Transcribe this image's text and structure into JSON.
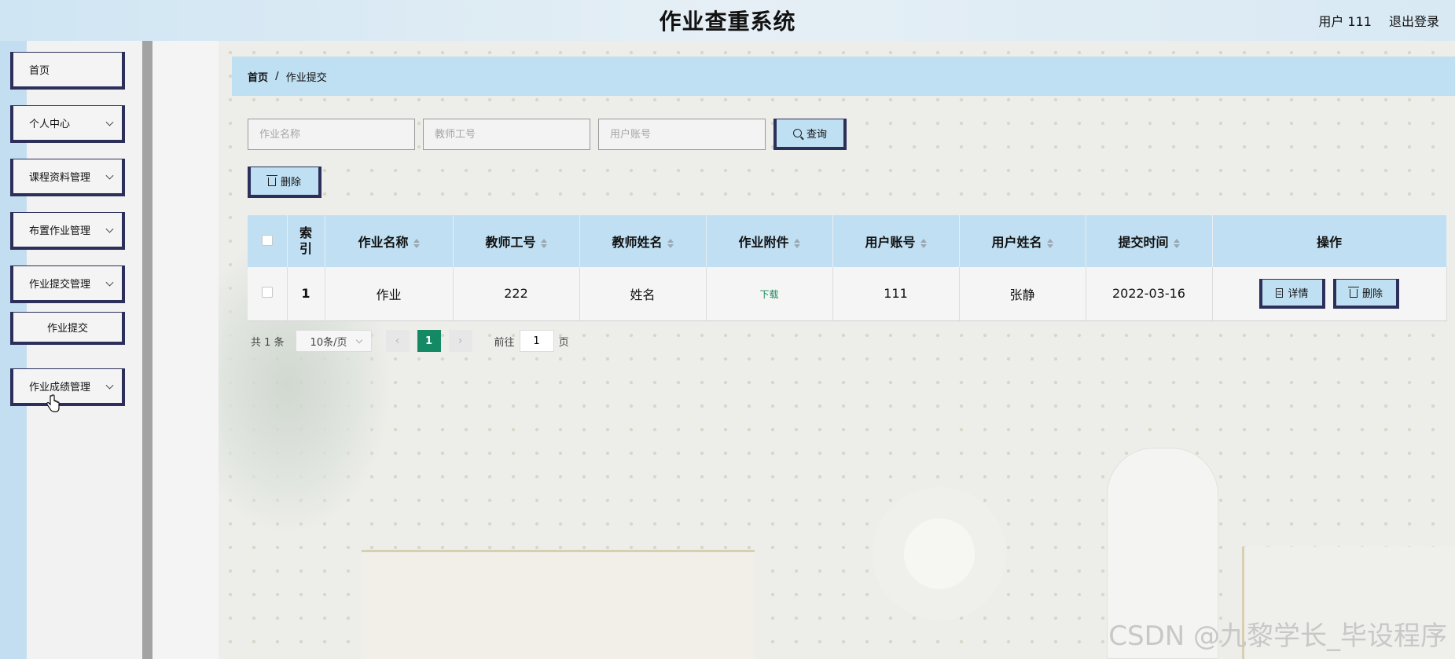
{
  "header": {
    "title": "作业查重系统",
    "user_label": "用户 111",
    "logout_label": "退出登录"
  },
  "sidebar": {
    "items": [
      {
        "label": "首页"
      },
      {
        "label": "个人中心"
      },
      {
        "label": "课程资料管理"
      },
      {
        "label": "布置作业管理"
      },
      {
        "label": "作业提交管理"
      },
      {
        "label": "作业提交"
      },
      {
        "label": "作业成绩管理"
      }
    ]
  },
  "breadcrumb": {
    "home": "首页",
    "separator": "/",
    "current": "作业提交"
  },
  "search": {
    "homework_name_placeholder": "作业名称",
    "teacher_id_placeholder": "教师工号",
    "user_account_placeholder": "用户账号",
    "query_label": "查询"
  },
  "toolbar": {
    "delete_label": "删除"
  },
  "table": {
    "columns": [
      "索引",
      "作业名称",
      "教师工号",
      "教师姓名",
      "作业附件",
      "用户账号",
      "用户姓名",
      "提交时间",
      "操作"
    ],
    "rows": [
      {
        "index": "1",
        "homework_name": "作业",
        "teacher_id": "222",
        "teacher_name": "姓名",
        "attachment": "下载",
        "user_account": "111",
        "user_name": "张静",
        "submit_time": "2022-03-16",
        "detail_label": "详情",
        "delete_label": "删除"
      }
    ]
  },
  "pagination": {
    "total": "共 1 条",
    "page_size": "10条/页",
    "prev": "‹",
    "current_page": "1",
    "next": "›",
    "goto_label": "前往",
    "goto_value": "1",
    "page_suffix": "页"
  },
  "watermark": "CSDN @九黎学长_毕设程序",
  "colors": {
    "accent_blue": "#bfdff2",
    "border_navy": "#2b2f5a",
    "page_active": "#138a63",
    "download_link": "#1a8a5a"
  }
}
